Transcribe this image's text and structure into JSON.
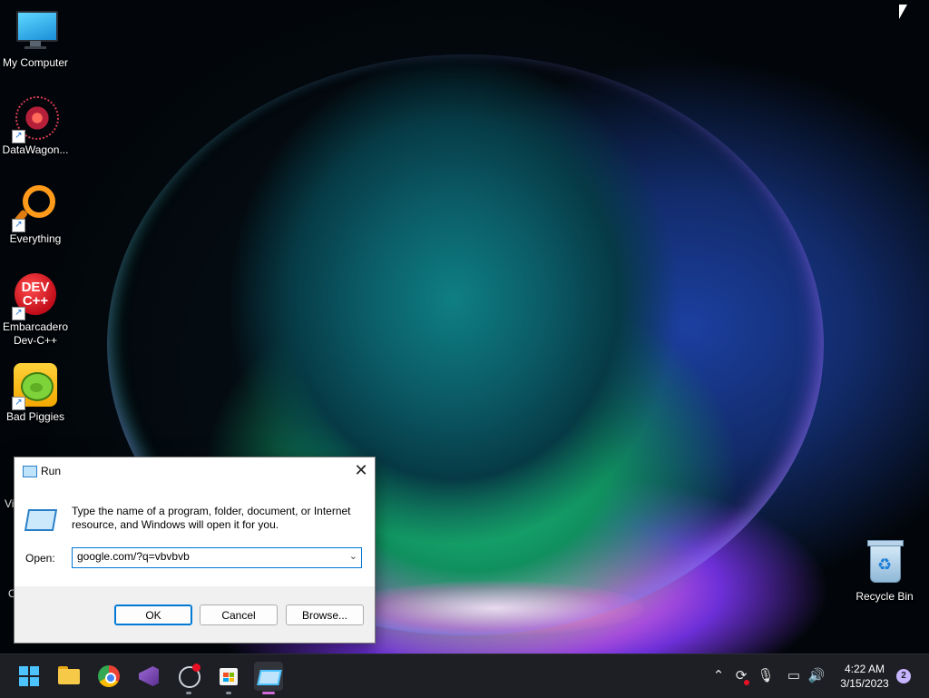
{
  "desktop": {
    "icons": [
      {
        "label": "My Computer"
      },
      {
        "label": "DataWagon..."
      },
      {
        "label": "Everything"
      },
      {
        "label": "Embarcadero\nDev-C++"
      },
      {
        "label": "Bad Piggies"
      },
      {
        "label": "Recycle Bin"
      }
    ],
    "partial_labels": [
      "Vi",
      "O"
    ],
    "devcpp_icon_text": "DEV\nC++"
  },
  "run_dialog": {
    "title": "Run",
    "description": "Type the name of a program, folder, document, or Internet resource, and Windows will open it for you.",
    "open_label": "Open:",
    "input_value": "google.com/?q=vbvbvb",
    "ok_label": "OK",
    "cancel_label": "Cancel",
    "browse_label": "Browse..."
  },
  "taskbar": {
    "apps": [
      "start-icon",
      "file-explorer-icon",
      "chrome-icon",
      "visual-studio-icon",
      "obs-icon",
      "microsoft-store-icon",
      "run-icon"
    ],
    "clock_time": "4:22 AM",
    "clock_date": "3/15/2023",
    "notification_count": "2",
    "accent_color": "#4cc2ff"
  }
}
